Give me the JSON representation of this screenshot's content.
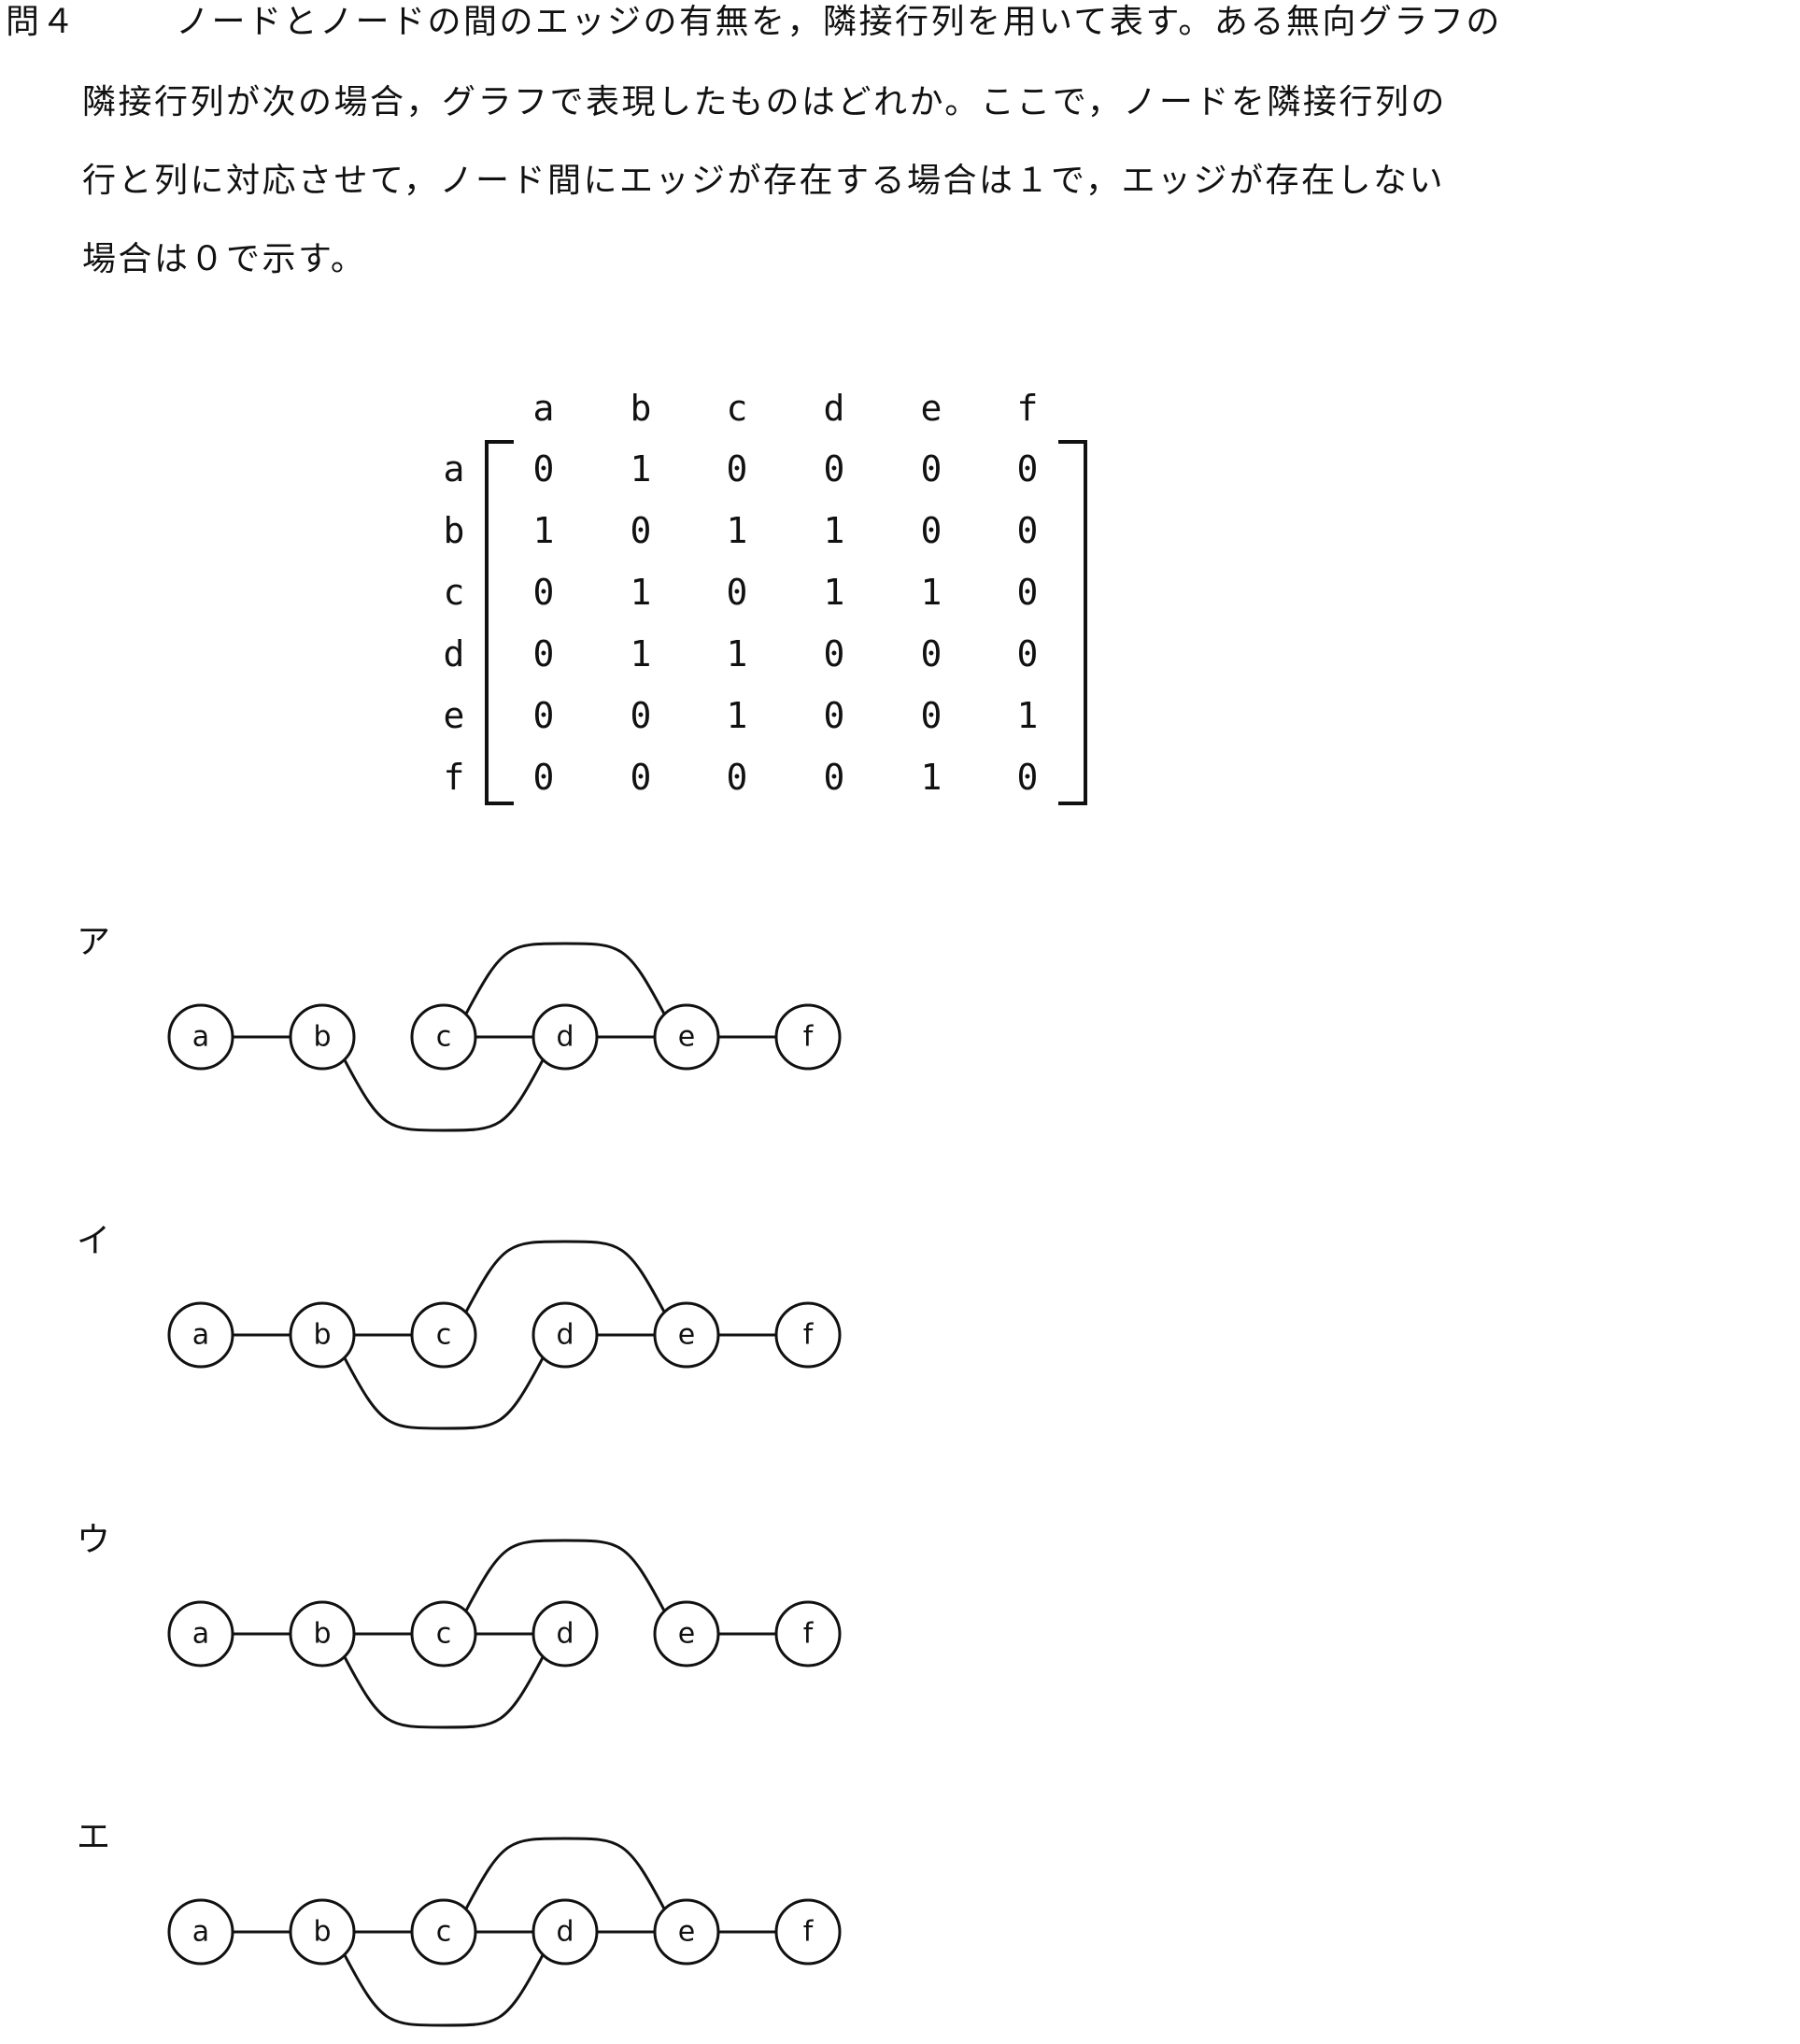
{
  "question": {
    "label": "問４",
    "lines": [
      "ノードとノードの間のエッジの有無を，隣接行列を用いて表す。ある無向グラフの",
      "隣接行列が次の場合，グラフで表現したものはどれか。ここで，ノードを隣接行列の",
      "行と列に対応させて，ノード間にエッジが存在する場合は１で，エッジが存在しない",
      "場合は０で示す。"
    ]
  },
  "matrix": {
    "col_labels": [
      "a",
      "b",
      "c",
      "d",
      "e",
      "f"
    ],
    "row_labels": [
      "a",
      "b",
      "c",
      "d",
      "e",
      "f"
    ],
    "rows": [
      [
        "0",
        "1",
        "0",
        "0",
        "0",
        "0"
      ],
      [
        "1",
        "0",
        "1",
        "1",
        "0",
        "0"
      ],
      [
        "0",
        "1",
        "0",
        "1",
        "1",
        "0"
      ],
      [
        "0",
        "1",
        "1",
        "0",
        "0",
        "0"
      ],
      [
        "0",
        "0",
        "1",
        "0",
        "0",
        "1"
      ],
      [
        "0",
        "0",
        "0",
        "0",
        "1",
        "0"
      ]
    ]
  },
  "choices": [
    {
      "label": "ア",
      "nodes": [
        "a",
        "b",
        "c",
        "d",
        "e",
        "f"
      ],
      "straight_edges": [
        [
          "a",
          "b"
        ],
        [
          "c",
          "d"
        ],
        [
          "d",
          "e"
        ],
        [
          "e",
          "f"
        ]
      ],
      "upper_arcs": [
        [
          "c",
          "e"
        ]
      ],
      "lower_arcs": [
        [
          "b",
          "d"
        ]
      ]
    },
    {
      "label": "イ",
      "nodes": [
        "a",
        "b",
        "c",
        "d",
        "e",
        "f"
      ],
      "straight_edges": [
        [
          "a",
          "b"
        ],
        [
          "b",
          "c"
        ],
        [
          "d",
          "e"
        ],
        [
          "e",
          "f"
        ]
      ],
      "upper_arcs": [
        [
          "c",
          "e"
        ]
      ],
      "lower_arcs": [
        [
          "b",
          "d"
        ]
      ]
    },
    {
      "label": "ウ",
      "nodes": [
        "a",
        "b",
        "c",
        "d",
        "e",
        "f"
      ],
      "straight_edges": [
        [
          "a",
          "b"
        ],
        [
          "b",
          "c"
        ],
        [
          "c",
          "d"
        ],
        [
          "e",
          "f"
        ]
      ],
      "upper_arcs": [
        [
          "c",
          "e"
        ]
      ],
      "lower_arcs": [
        [
          "b",
          "d"
        ]
      ]
    },
    {
      "label": "エ",
      "nodes": [
        "a",
        "b",
        "c",
        "d",
        "e",
        "f"
      ],
      "straight_edges": [
        [
          "a",
          "b"
        ],
        [
          "b",
          "c"
        ],
        [
          "c",
          "d"
        ],
        [
          "d",
          "e"
        ],
        [
          "e",
          "f"
        ]
      ],
      "upper_arcs": [
        [
          "c",
          "e"
        ]
      ],
      "lower_arcs": [
        [
          "b",
          "d"
        ]
      ]
    }
  ]
}
